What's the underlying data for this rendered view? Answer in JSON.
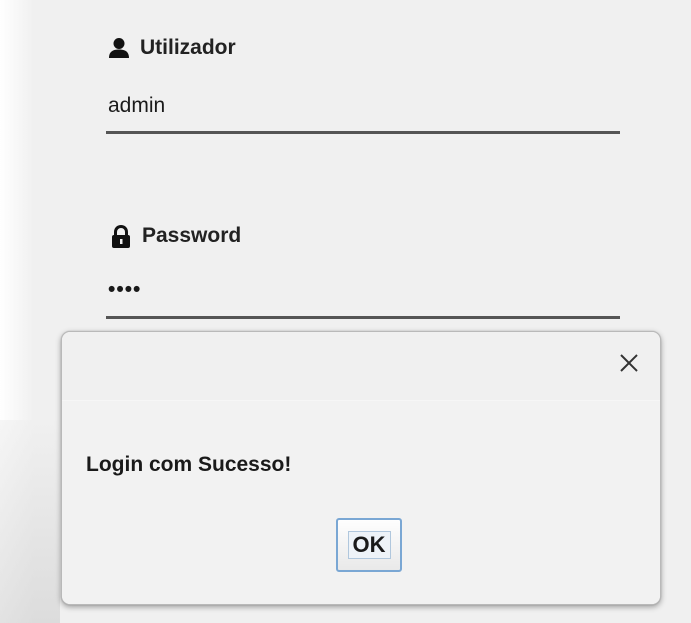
{
  "login_form": {
    "username_label": "Utilizador",
    "username_value": "admin",
    "password_label": "Password",
    "password_value": "••••"
  },
  "dialog": {
    "close_symbol": "✕",
    "message": "Login com Sucesso!",
    "ok_label": "OK"
  },
  "icons": {
    "user": "user-icon",
    "lock": "lock-icon",
    "close": "close-icon"
  }
}
